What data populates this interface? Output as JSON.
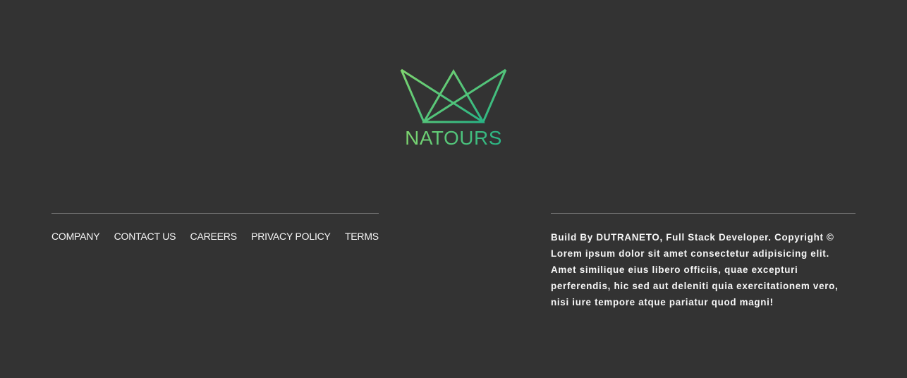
{
  "logo": {
    "text": "NATOURS",
    "icon": "crown-icon",
    "gradient_start": "#7ed56f",
    "gradient_end": "#28b485"
  },
  "nav": {
    "items": [
      {
        "label": "COMPANY"
      },
      {
        "label": "CONTACT US"
      },
      {
        "label": "CAREERS"
      },
      {
        "label": "PRIVACY POLICY"
      },
      {
        "label": "TERMS"
      }
    ]
  },
  "copyright": {
    "text": "Build By DUTRANETO, Full Stack Developer. Copyright © Lorem ipsum dolor sit amet consectetur adipisicing elit. Amet similique eius libero officiis, quae excepturi perferendis, hic sed aut deleniti quia exercitationem vero, nisi iure tempore atque pariatur quod magni!"
  },
  "colors": {
    "background": "#333333",
    "text": "#f7f7f7",
    "divider": "#777777"
  }
}
